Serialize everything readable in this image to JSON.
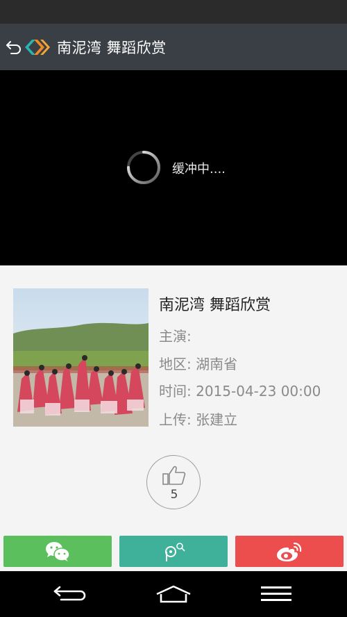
{
  "header": {
    "title": "南泥湾 舞蹈欣赏"
  },
  "player": {
    "buffering_text": "缓冲中...."
  },
  "video_info": {
    "title": "南泥湾 舞蹈欣赏",
    "lead_label": "主演:",
    "lead_value": "",
    "region_label": "地区:",
    "region_value": "湖南省",
    "time_label": "时间:",
    "time_value": "2015-04-23 00:00",
    "uploader_label": "上传:",
    "uploader_value": "张建立"
  },
  "like": {
    "count": "5"
  },
  "share": {
    "buttons": [
      {
        "icon": "wechat-icon",
        "color": "#5cbf5e"
      },
      {
        "icon": "moments-icon",
        "color": "#3fb19b"
      },
      {
        "icon": "weibo-icon",
        "color": "#ec4e4e"
      }
    ]
  },
  "colors": {
    "title_bar": "#3a3f45",
    "logo_teal": "#2bb3b1",
    "logo_orange": "#f08a24"
  }
}
